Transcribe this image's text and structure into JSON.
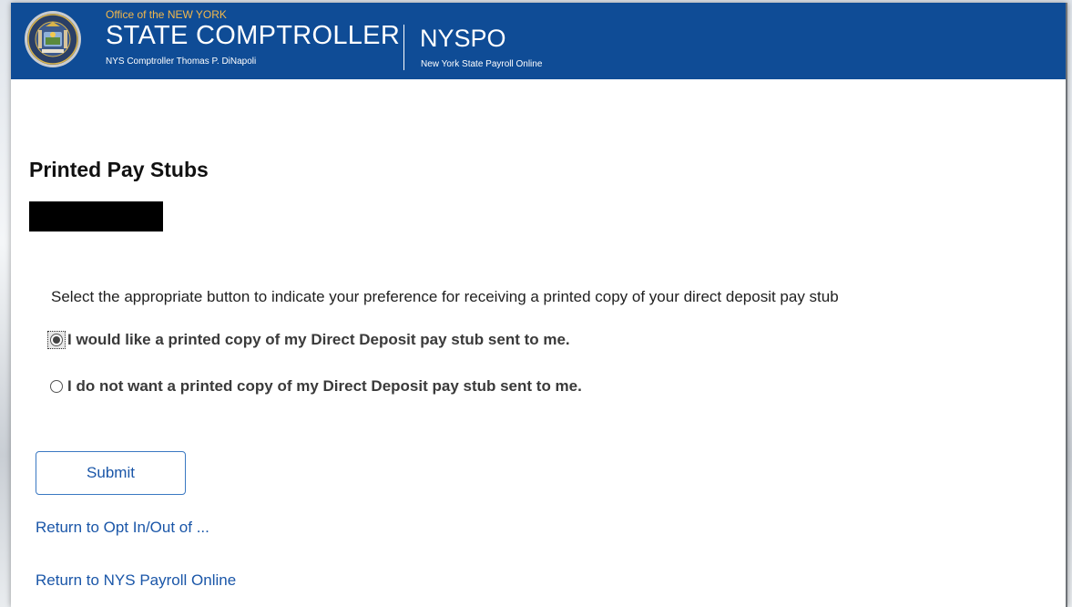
{
  "header": {
    "tagline": "Office of the NEW YORK",
    "title": "STATE COMPTROLLER",
    "subtitle": "NYS Comptroller Thomas P. DiNapoli",
    "app_title": "NYSPO",
    "app_subtitle": "New York State Payroll Online",
    "logo_icon": "nys-seal-icon",
    "background_color": "#0f4c96",
    "tagline_color": "#f3b84b"
  },
  "page": {
    "title": "Printed Pay Stubs",
    "instructions": "Select the appropriate button to indicate your preference for receiving a printed copy of your direct deposit pay stub"
  },
  "options": [
    {
      "label": "I would like a printed copy of my Direct Deposit pay stub sent to me.",
      "selected": true
    },
    {
      "label": "I do not want a printed copy of my Direct Deposit pay stub sent to me.",
      "selected": false
    }
  ],
  "actions": {
    "submit_label": "Submit"
  },
  "links": {
    "return_opt": "Return to Opt In/Out of ...",
    "return_nyspo": "Return to NYS Payroll Online"
  },
  "colors": {
    "link": "#1a56a8",
    "button_border": "#3a78c2"
  }
}
